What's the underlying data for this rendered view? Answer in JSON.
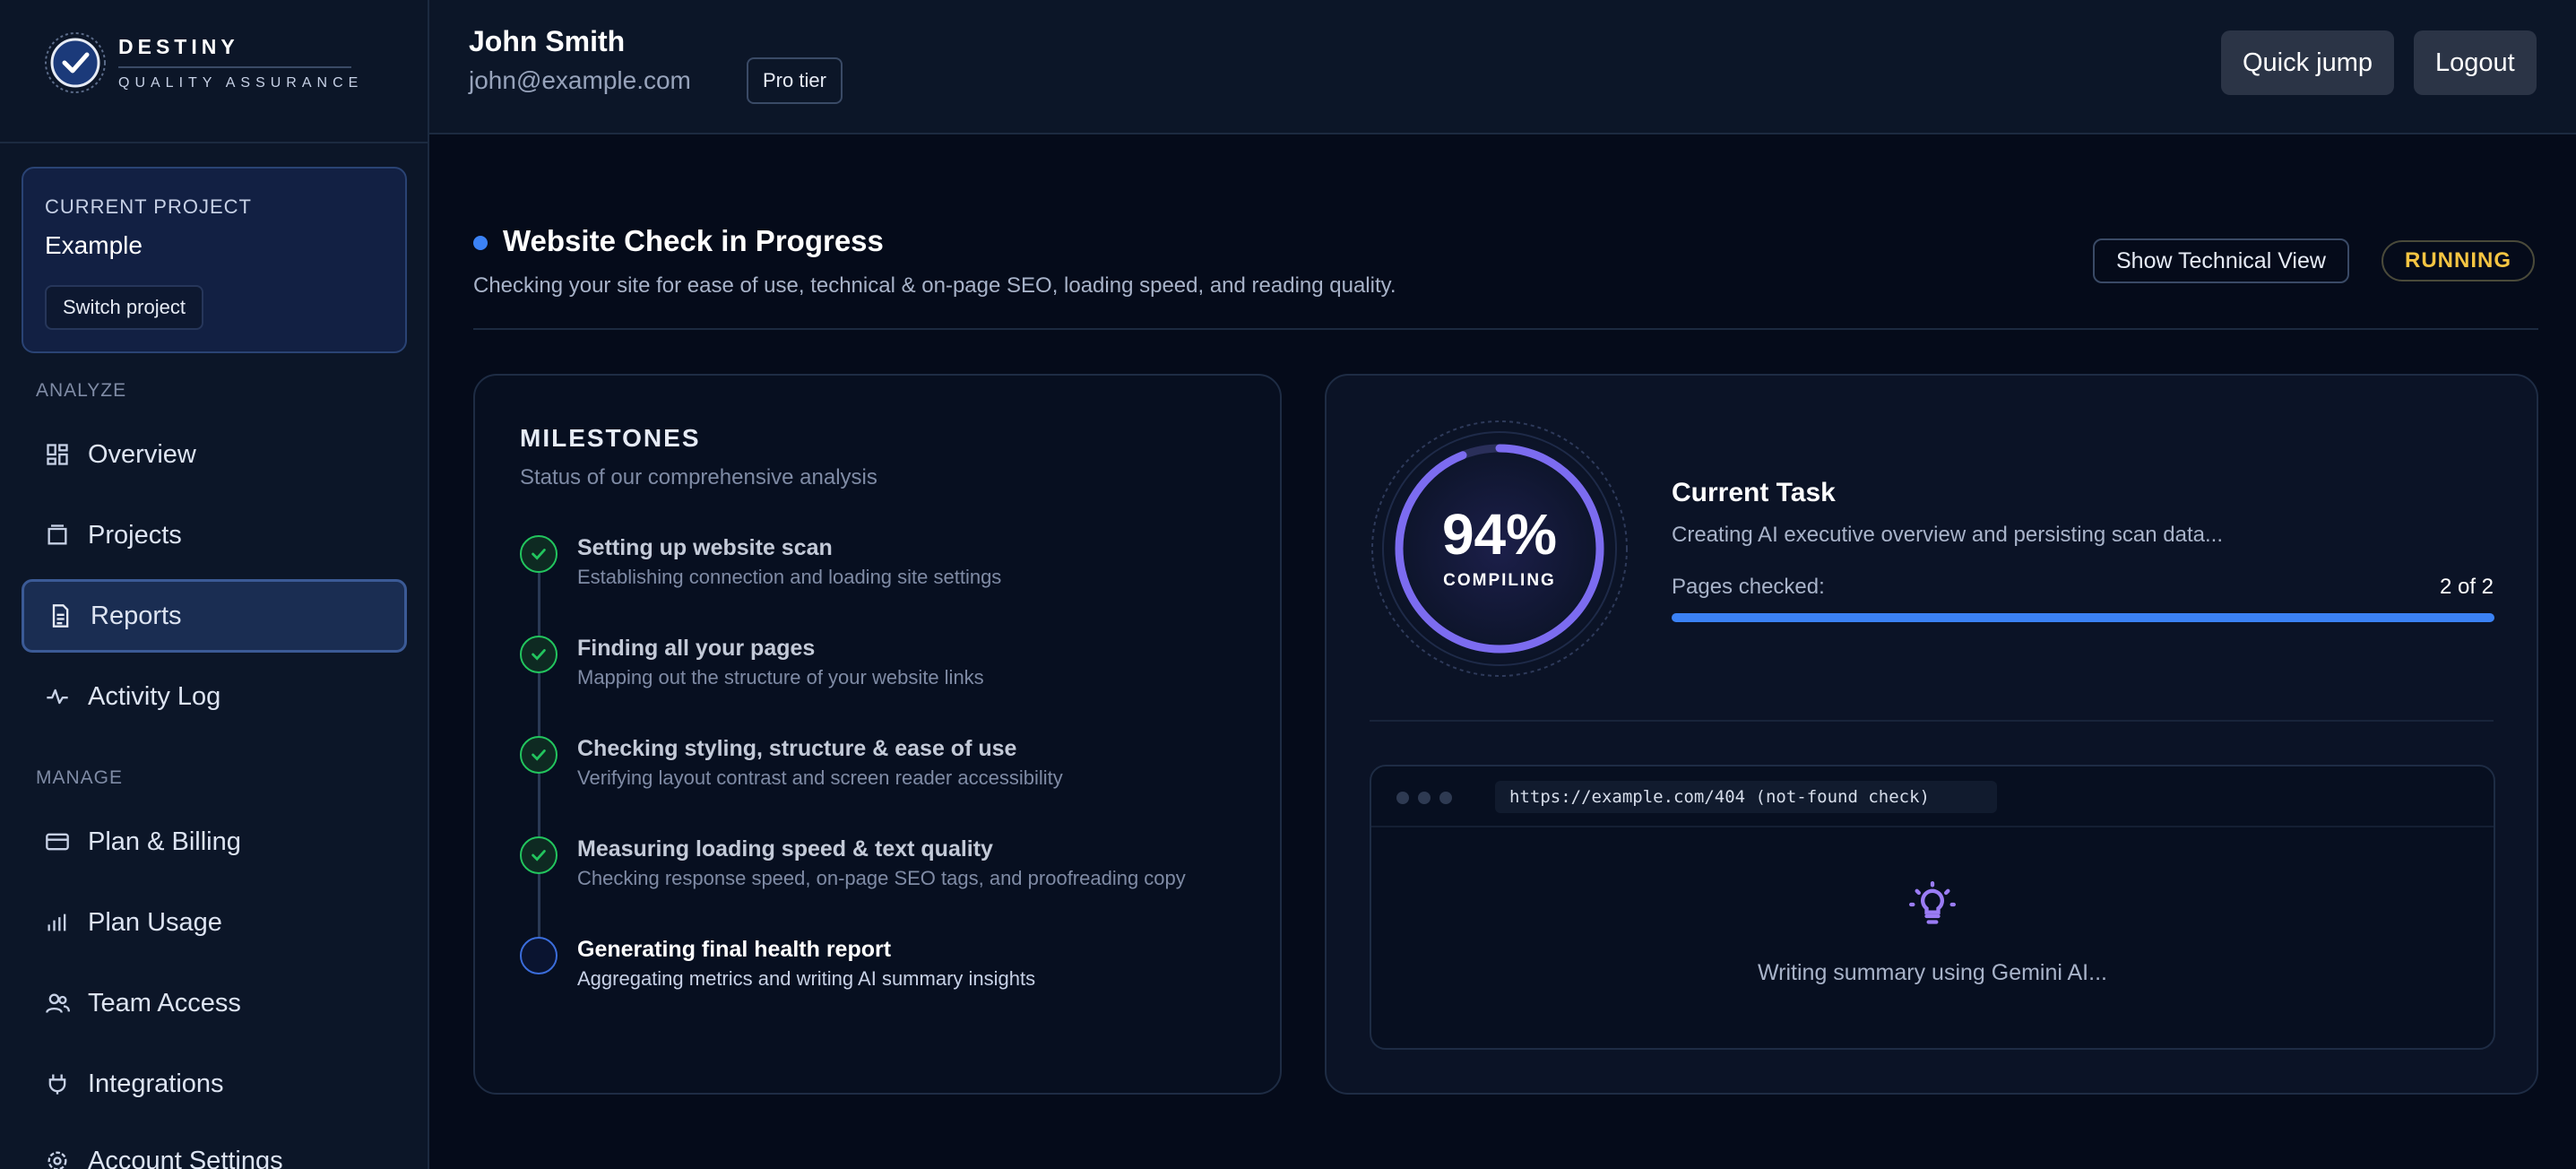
{
  "brand": {
    "name": "DESTINY",
    "tagline": "QUALITY ASSURANCE"
  },
  "project": {
    "label": "CURRENT PROJECT",
    "name": "Example",
    "switch_label": "Switch project"
  },
  "nav": {
    "analyze_heading": "ANALYZE",
    "manage_heading": "MANAGE",
    "items": [
      {
        "label": "Overview",
        "icon": "dashboard-icon"
      },
      {
        "label": "Projects",
        "icon": "folder-icon"
      },
      {
        "label": "Reports",
        "icon": "document-icon",
        "active": true
      },
      {
        "label": "Activity Log",
        "icon": "activity-icon"
      },
      {
        "label": "Plan & Billing",
        "icon": "credit-card-icon"
      },
      {
        "label": "Plan Usage",
        "icon": "bar-chart-icon"
      },
      {
        "label": "Team Access",
        "icon": "users-icon"
      },
      {
        "label": "Integrations",
        "icon": "plug-icon"
      },
      {
        "label": "Account Settings",
        "icon": "gear-icon"
      }
    ]
  },
  "header": {
    "user_name": "John Smith",
    "user_email": "john@example.com",
    "tier": "Pro tier",
    "quick_jump": "Quick jump",
    "logout": "Logout"
  },
  "main": {
    "title": "Website Check in Progress",
    "subtitle": "Checking your site for ease of use, technical & on-page SEO, loading speed, and reading quality.",
    "tech_view_label": "Show Technical View",
    "status": "RUNNING"
  },
  "milestones": {
    "title": "MILESTONES",
    "subtitle": "Status of our comprehensive analysis",
    "items": [
      {
        "name": "Setting up website scan",
        "desc": "Establishing connection and loading site settings",
        "state": "done"
      },
      {
        "name": "Finding all your pages",
        "desc": "Mapping out the structure of your website links",
        "state": "done"
      },
      {
        "name": "Checking styling, structure & ease of use",
        "desc": "Verifying layout contrast and screen reader accessibility",
        "state": "done"
      },
      {
        "name": "Measuring loading speed & text quality",
        "desc": "Checking response speed, on-page SEO tags, and proofreading copy",
        "state": "done"
      },
      {
        "name": "Generating final health report",
        "desc": "Aggregating metrics and writing AI summary insights",
        "state": "current"
      }
    ]
  },
  "task": {
    "percent_label": "94%",
    "percent_value": 94,
    "phase": "COMPILING",
    "title": "Current Task",
    "desc": "Creating AI executive overview and persisting scan data...",
    "pages_label": "Pages checked:",
    "pages_value": "2 of 2",
    "pages_progress": 1.0,
    "url": "https://example.com/404 (not-found check)",
    "message": "Writing summary using Gemini AI..."
  },
  "colors": {
    "accent": "#3b82f6",
    "ring": "#7c6cf0",
    "done": "#22c55e",
    "running": "#f5c542"
  }
}
